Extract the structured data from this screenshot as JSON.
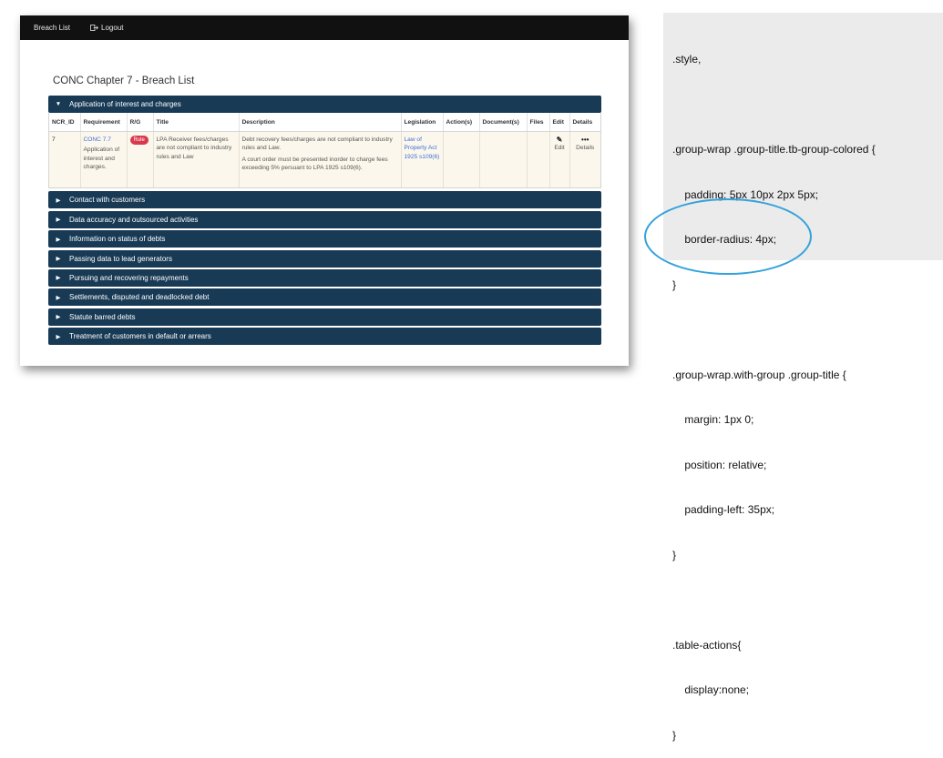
{
  "nav": {
    "breach_list": "Breach List",
    "logout": "Logout"
  },
  "page": {
    "title": "CONC Chapter 7 - Breach List"
  },
  "groups": [
    {
      "label": "Application of interest and charges",
      "expanded": true,
      "table": {
        "headers": [
          "NCR_ID",
          "Requirement",
          "R/G",
          "Title",
          "Description",
          "Legislation",
          "Action(s)",
          "Document(s)",
          "Files",
          "Edit",
          "Details"
        ],
        "rows": [
          {
            "ncr_id": "7",
            "requirement_link": "CONC 7.7",
            "requirement_text": "Application of interest and charges.",
            "rg_badge": "Rule",
            "title": "LPA Receiver fees/charges are not compliant to industry rules and Law",
            "description_1": "Debt recovery fees/charges are not compliant to industry rules and Law.",
            "description_2": "A court order must be presented inorder to charge fees exceeding 5% persuant to LPA 1925 s109(6).",
            "legislation": "Law of Property Act 1925 s109(6)",
            "actions": "",
            "documents": "",
            "files": "",
            "edit_label": "Edit",
            "edit_icon": "pencil-icon",
            "details_label": "Details",
            "details_icon": "ellipsis-icon"
          }
        ]
      }
    },
    {
      "label": "Contact with customers",
      "expanded": false
    },
    {
      "label": "Data accuracy and outsourced activities",
      "expanded": false
    },
    {
      "label": "Information on status of debts",
      "expanded": false
    },
    {
      "label": "Passing data to lead generators",
      "expanded": false
    },
    {
      "label": "Pursuing and recovering repayments",
      "expanded": false
    },
    {
      "label": "Settlements, disputed and deadlocked debt",
      "expanded": false
    },
    {
      "label": "Statute barred debts",
      "expanded": false
    },
    {
      "label": "Treatment of customers in default or arrears",
      "expanded": false
    }
  ],
  "code_panel": {
    "lines": [
      ".style,",
      "",
      ".group-wrap .group-title.tb-group-colored {",
      "    padding: 5px 10px 2px 5px;",
      "    border-radius: 4px;",
      "}",
      "",
      ".group-wrap.with-group .group-title {",
      "    margin: 1px 0;",
      "    position: relative;",
      "    padding-left: 35px;",
      "}",
      "",
      ".table-actions{",
      "    display:none;",
      "}"
    ],
    "highlight_color": "#33a2db"
  },
  "colors": {
    "nav_bg": "#111111",
    "group_header_bg": "#183a55",
    "row_bg": "#fbf7ec",
    "link": "#3f6fd8",
    "rule_badge": "#d9384d"
  }
}
